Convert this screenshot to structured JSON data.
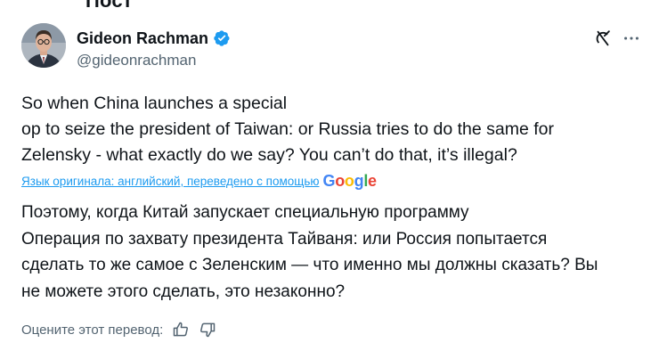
{
  "header": {
    "title": "Пост"
  },
  "author": {
    "display_name": "Gideon Rachman",
    "handle": "@gideonrachman",
    "verified": true,
    "verified_color": "#1d9bf0"
  },
  "tweet": {
    "text": "So when China launches a special\nop to seize the president of Taiwan: or Russia tries to do the same for\nZelensky - what exactly do we say? You can’t do that, it’s illegal?"
  },
  "translation": {
    "note": "Язык оригинала: английский, переведено с помощью",
    "provider": "Google",
    "text": "Поэтому, когда Китай запускает специальную программу\nОперация по захвату президента Тайваня: или Россия попытается\nсделать то же самое с Зеленским — что именно мы должны сказать? Вы\nне можете этого сделать, это незаконно?"
  },
  "rating": {
    "label": "Оцените этот перевод:",
    "like_icon": "thumbs-up-icon",
    "dislike_icon": "thumbs-down-icon"
  },
  "icons": {
    "grok": "grok-icon",
    "more": "more-icon"
  },
  "colors": {
    "text": "#0f1419",
    "secondary": "#536471",
    "link": "#1d9bf0"
  }
}
